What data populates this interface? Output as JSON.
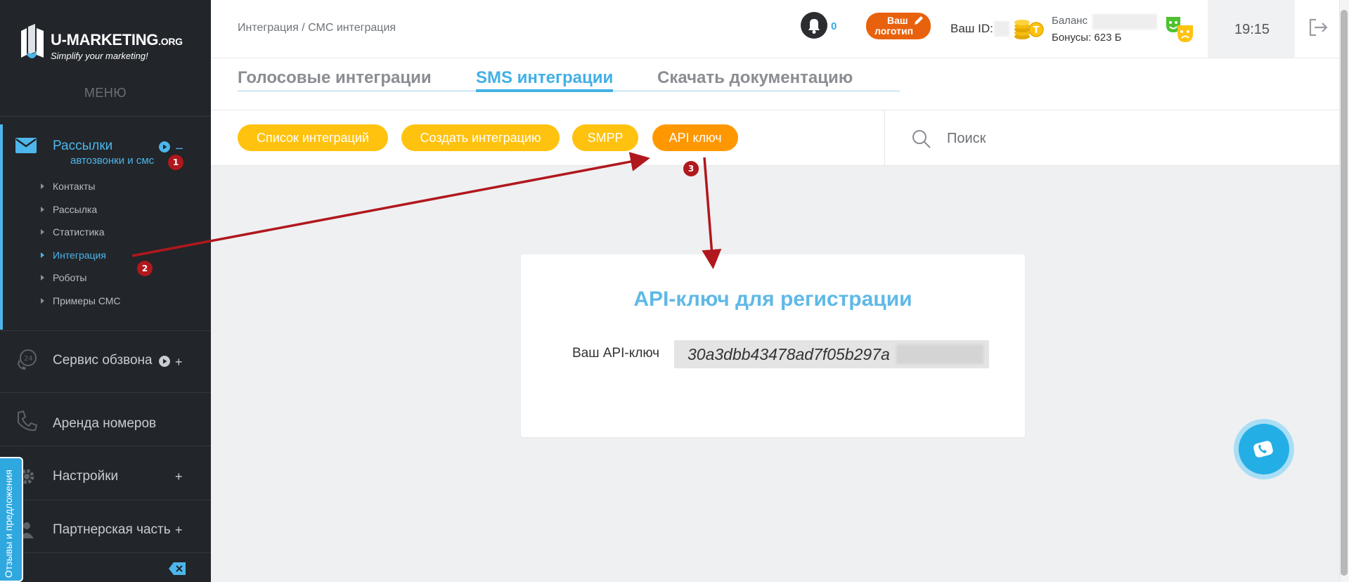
{
  "app": {
    "logo_title": "U-MARKETING",
    "logo_title_suffix": ".ORG",
    "logo_subtitle": "Simplify your marketing!"
  },
  "sidebar": {
    "menu_heading": "МЕНЮ",
    "sections": [
      {
        "label": "Рассылки",
        "sub": "автозвонки и смс",
        "toggle": "–",
        "active": true
      },
      {
        "label": "Сервис обзвона",
        "toggle": "+"
      },
      {
        "label": "Аренда номеров"
      },
      {
        "label": "Настройки",
        "toggle": "+"
      },
      {
        "label": "Партнерская часть",
        "toggle": "+"
      }
    ],
    "subitems": [
      "Контакты",
      "Рассылка",
      "Статистика",
      "Интеграция",
      "Роботы",
      "Примеры СМС"
    ],
    "active_subitem": "Интеграция",
    "feedback_tab": "Отзывы и предложения",
    "accent_color": "#4db6ea",
    "bg_color": "#22252a"
  },
  "header": {
    "breadcrumb": "Интеграция / СМС интеграция",
    "notifications_count": "0",
    "your_logo_line1": "Ваш",
    "your_logo_line2": "логотип",
    "your_id_label": "Ваш ID:",
    "balance_label": "Баланс",
    "bonus_text": "Бонусы: 623 Б",
    "time": "19:15"
  },
  "tabs": {
    "items": [
      "Голосовые интеграции",
      "SMS интеграции",
      "Скачать документацию"
    ],
    "active": "SMS интеграции"
  },
  "toolbar": {
    "buttons": [
      "Список интеграций",
      "Создать интеграцию",
      "SMPP",
      "API ключ"
    ],
    "active": "API ключ",
    "search_placeholder": "Поиск",
    "pill_color": "#ffc20e",
    "active_pill_color": "#ff9800"
  },
  "card": {
    "title": "API-ключ для регистрации",
    "label": "Ваш API-ключ",
    "api_key_visible": "30a3dbb43478ad7f05b297a"
  },
  "annotations": {
    "badges": [
      "1",
      "2",
      "3"
    ],
    "color": "#b0181d"
  }
}
